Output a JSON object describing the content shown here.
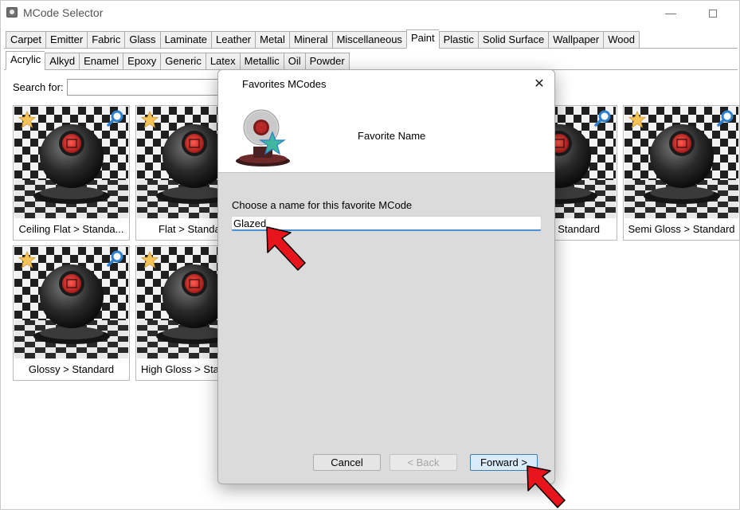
{
  "window": {
    "title": "MCode Selector",
    "minimize": "—",
    "maximize": ""
  },
  "category_tabs": [
    {
      "label": "Carpet",
      "selected": false
    },
    {
      "label": "Emitter",
      "selected": false
    },
    {
      "label": "Fabric",
      "selected": false
    },
    {
      "label": "Glass",
      "selected": false
    },
    {
      "label": "Laminate",
      "selected": false
    },
    {
      "label": "Leather",
      "selected": false
    },
    {
      "label": "Metal",
      "selected": false
    },
    {
      "label": "Mineral",
      "selected": false
    },
    {
      "label": "Miscellaneous",
      "selected": false
    },
    {
      "label": "Paint",
      "selected": true
    },
    {
      "label": "Plastic",
      "selected": false
    },
    {
      "label": "Solid Surface",
      "selected": false
    },
    {
      "label": "Wallpaper",
      "selected": false
    },
    {
      "label": "Wood",
      "selected": false
    }
  ],
  "paint_tabs": [
    {
      "label": "Acrylic",
      "selected": true
    },
    {
      "label": "Alkyd",
      "selected": false
    },
    {
      "label": "Enamel",
      "selected": false
    },
    {
      "label": "Epoxy",
      "selected": false
    },
    {
      "label": "Generic",
      "selected": false
    },
    {
      "label": "Latex",
      "selected": false
    },
    {
      "label": "Metallic",
      "selected": false
    },
    {
      "label": "Oil",
      "selected": false
    },
    {
      "label": "Powder",
      "selected": false
    }
  ],
  "search": {
    "label": "Search for:",
    "value": ""
  },
  "tiles": [
    {
      "caption": "Ceiling Flat > Standa...",
      "favorite_icon": "star-icon",
      "zoom_icon": "magnifier-icon"
    },
    {
      "caption": "Flat > Standa",
      "favorite_icon": "star-icon",
      "zoom_icon": "magnifier-icon"
    },
    {
      "caption": "Standard",
      "favorite_icon": "star-icon",
      "zoom_icon": "magnifier-icon"
    },
    {
      "caption": "Semi Gloss > Standard",
      "favorite_icon": "star-icon",
      "zoom_icon": "magnifier-icon"
    },
    {
      "caption": "Glossy > Standard",
      "favorite_icon": "star-icon",
      "zoom_icon": "magnifier-icon"
    },
    {
      "caption": "High Gloss > Sta",
      "favorite_icon": "star-icon",
      "zoom_icon": "magnifier-icon"
    }
  ],
  "dialog": {
    "title": "Favorites MCodes",
    "close": "✕",
    "step_title": "Favorite Name",
    "prompt": "Choose a name for this favorite MCode",
    "name_value": "Glazed",
    "cancel_label": "Cancel",
    "back_label": "< Back",
    "forward_label": "Forward >",
    "back_enabled": false
  },
  "colors": {
    "accent": "#4a8fd4",
    "annotation_arrow": "#e8141c",
    "star": "#f3c35a",
    "sphere_red": "#d6252b"
  }
}
